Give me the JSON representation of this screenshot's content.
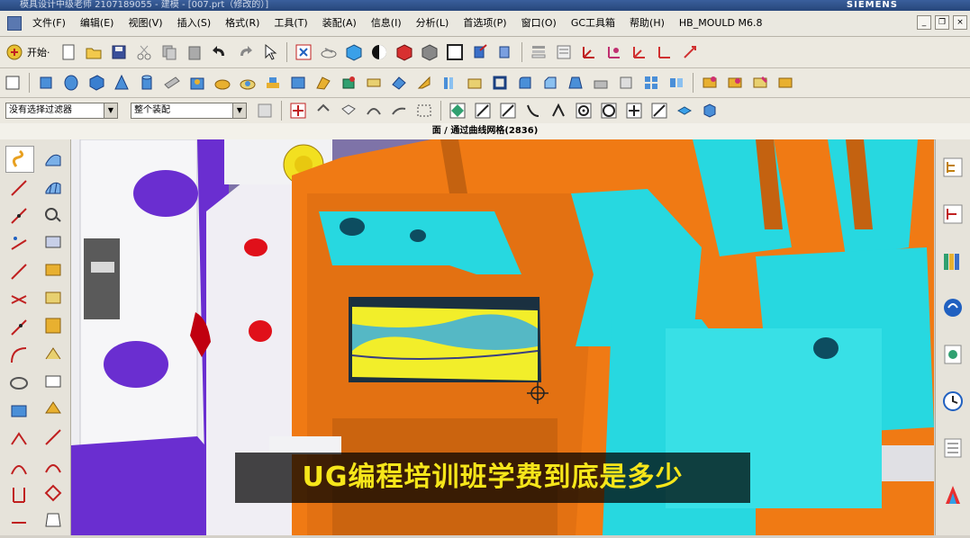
{
  "window": {
    "title": "模具设计中级老师 2107189055 - 建模 - [007.prt（修改的）]",
    "brand": "SIEMENS"
  },
  "menu": {
    "items": [
      "文件(F)",
      "编辑(E)",
      "视图(V)",
      "插入(S)",
      "格式(R)",
      "工具(T)",
      "装配(A)",
      "信息(I)",
      "分析(L)",
      "首选项(P)",
      "窗口(O)",
      "GC工具箱",
      "帮助(H)",
      "HB_MOULD M6.8"
    ]
  },
  "toolbar": {
    "start_label": "开始·"
  },
  "filter": {
    "selection_filter": "没有选择过滤器",
    "assembly_scope": "整个装配"
  },
  "status": {
    "prompt": "面 / 通过曲线网格(2836)"
  },
  "caption": {
    "text": "UG编程培训班学费到底是多少"
  },
  "colors": {
    "orange": "#f07a14",
    "cyan": "#27d8e0",
    "purple": "#6a2ed0",
    "white_plate": "#f2f2f4",
    "red_hole": "#e0101a",
    "yellow_face": "#f2ee2a"
  }
}
